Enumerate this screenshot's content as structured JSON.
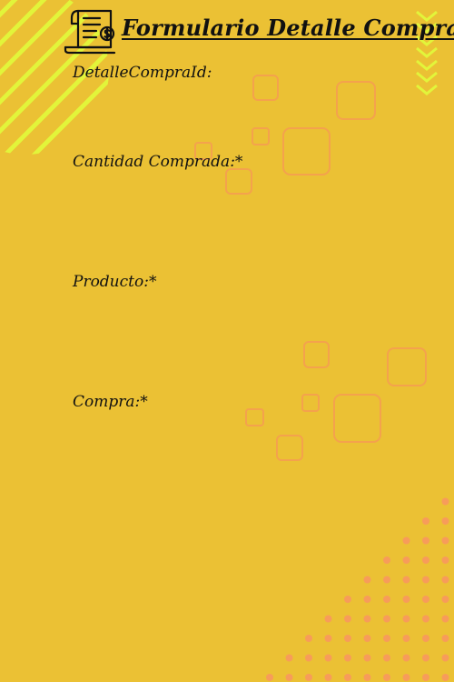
{
  "form": {
    "title": "Formulario Detalle Compra",
    "fields": [
      {
        "label": "DetalleCompraId:",
        "value": ""
      },
      {
        "label": "Cantidad Comprada:*",
        "value": ""
      },
      {
        "label": "Producto:*",
        "value": ""
      },
      {
        "label": "Compra:*",
        "value": ""
      }
    ]
  },
  "colors": {
    "background": "#ebc134",
    "stripes": "#e2f53a",
    "squares": "#f4a24d",
    "dots": "#f79c5a",
    "text": "#111111"
  },
  "icons": [
    "invoice-dollar-icon",
    "chevrons-down-icon"
  ]
}
